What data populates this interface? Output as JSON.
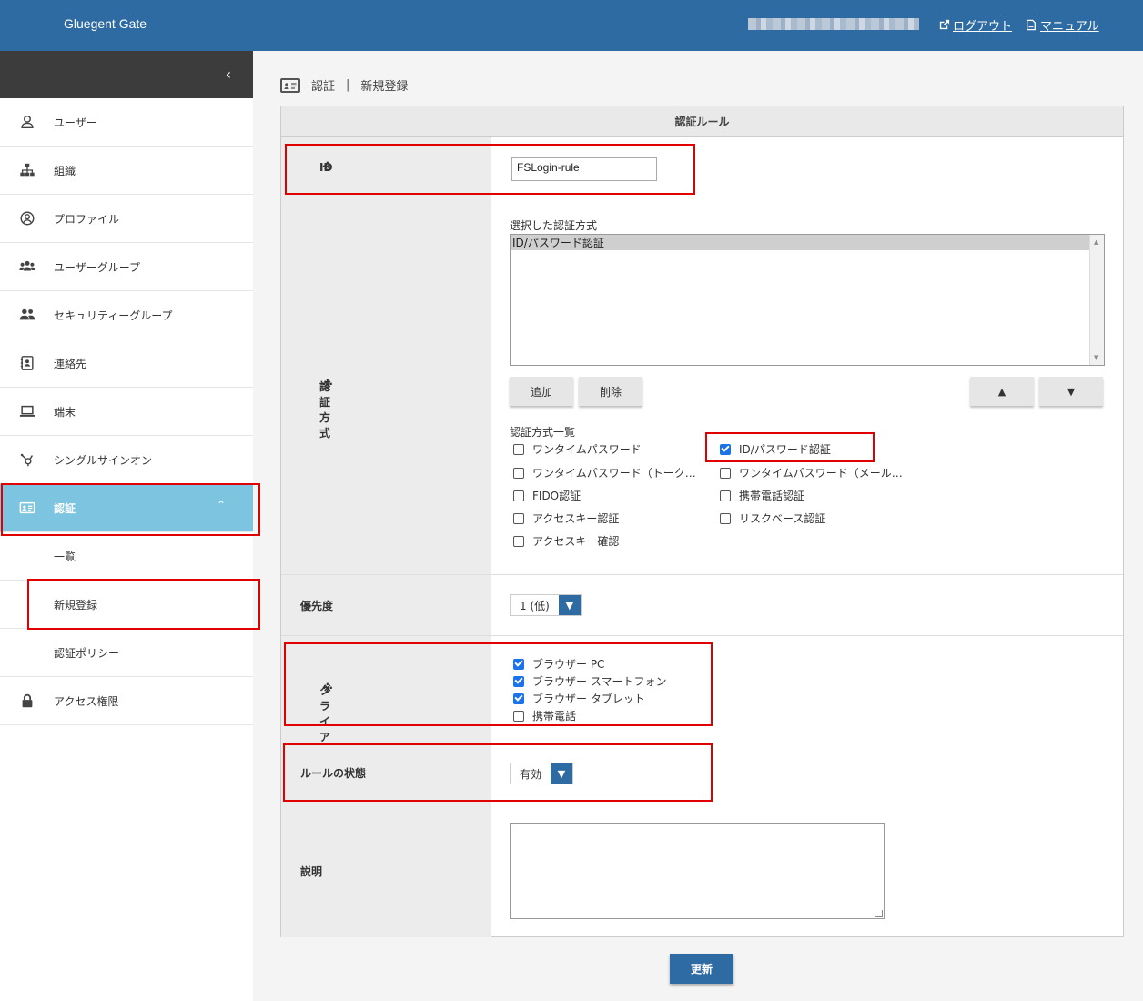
{
  "header": {
    "brand": "Gluegent Gate",
    "logout": "ログアウト",
    "manual": "マニュアル"
  },
  "sidebar": {
    "collapse_icon": "chevron-left-icon",
    "items": [
      {
        "label": "ユーザー",
        "icon": "user-icon"
      },
      {
        "label": "組織",
        "icon": "org-chart-icon"
      },
      {
        "label": "プロファイル",
        "icon": "profile-icon"
      },
      {
        "label": "ユーザーグループ",
        "icon": "users-group-icon"
      },
      {
        "label": "セキュリティーグループ",
        "icon": "security-group-icon"
      },
      {
        "label": "連絡先",
        "icon": "contact-book-icon"
      },
      {
        "label": "端末",
        "icon": "laptop-icon"
      },
      {
        "label": "シングルサインオン",
        "icon": "sso-icon"
      },
      {
        "label": "認証",
        "icon": "id-card-icon",
        "active": true
      },
      {
        "label": "アクセス権限",
        "icon": "lock-icon"
      }
    ],
    "sub_items": [
      {
        "label": "一覧"
      },
      {
        "label": "新規登録"
      },
      {
        "label": "認証ポリシー"
      }
    ]
  },
  "breadcrumb": {
    "section": "認証",
    "separator": "|",
    "page": "新規登録"
  },
  "form": {
    "heading": "認証ルール",
    "required_mark": "※",
    "id": {
      "label": "ID",
      "value": "FSLogin-rule"
    },
    "auth": {
      "label": "認証方式",
      "selected_title": "選択した認証方式",
      "selected": [
        "ID/パスワード認証"
      ],
      "add": "追加",
      "delete": "削除",
      "up": "▲",
      "down": "▼",
      "list_title": "認証方式一覧",
      "methods": [
        {
          "label": "ワンタイムパスワード",
          "checked": false
        },
        {
          "label": "ID/パスワード認証",
          "checked": true
        },
        {
          "label": "ワンタイムパスワード（トーク…",
          "checked": false
        },
        {
          "label": "ワンタイムパスワード（メール…",
          "checked": false
        },
        {
          "label": "FIDO認証",
          "checked": false
        },
        {
          "label": "携帯電話認証",
          "checked": false
        },
        {
          "label": "アクセスキー認証",
          "checked": false
        },
        {
          "label": "リスクベース認証",
          "checked": false
        },
        {
          "label": "アクセスキー確認",
          "checked": false
        }
      ]
    },
    "priority": {
      "label": "優先度",
      "value": "1 (低)"
    },
    "client": {
      "label": "クライアント",
      "options": [
        {
          "label": "ブラウザー PC",
          "checked": true
        },
        {
          "label": "ブラウザー スマートフォン",
          "checked": true
        },
        {
          "label": "ブラウザー タブレット",
          "checked": true
        },
        {
          "label": "携帯電話",
          "checked": false
        }
      ]
    },
    "status": {
      "label": "ルールの状態",
      "value": "有効"
    },
    "description": {
      "label": "説明",
      "value": ""
    },
    "submit": "更新"
  },
  "colors": {
    "header": "#2f6ba3",
    "active_nav": "#7cc4df",
    "highlight": "#e00000",
    "required": "#d9534f"
  }
}
